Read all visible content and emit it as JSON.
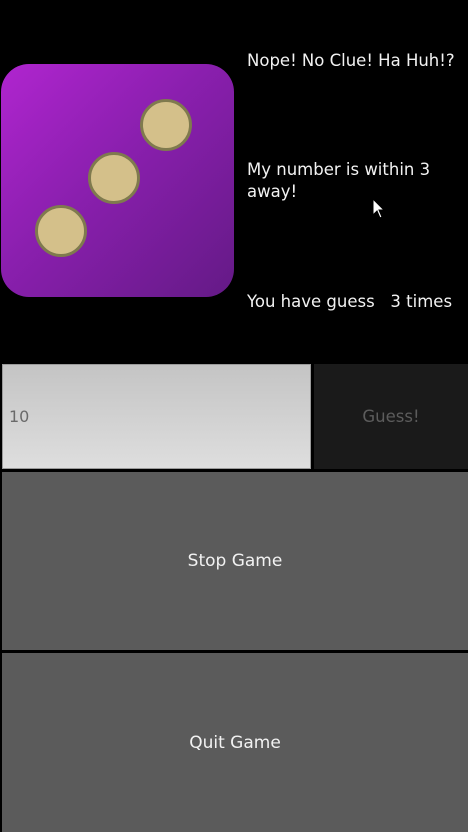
{
  "game": {
    "feedback": "Nope! No Clue! Ha Huh!?",
    "hint": "My number is within 3 away!",
    "guess_count": "You have guess   3 times"
  },
  "dice": {
    "face_value": 3,
    "colors": {
      "face_start": "#b025cf",
      "face_end": "#641a86",
      "pip": "#d4c08a"
    }
  },
  "input": {
    "value": "10"
  },
  "buttons": {
    "guess_label": "Guess!",
    "stop_label": "Stop Game",
    "quit_label": "Quit Game"
  }
}
